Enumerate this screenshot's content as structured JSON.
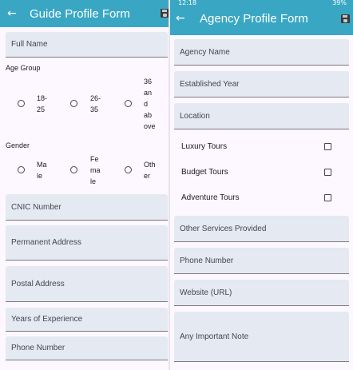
{
  "guide_form": {
    "status_time": "",
    "title": "Guide Profile Form",
    "fields": {
      "full_name": "Full Name",
      "cnic": "CNIC Number",
      "permanent_address": "Permanent Address",
      "postal_address": "Postal Address",
      "experience": "Years of Experience",
      "phone": "Phone Number"
    },
    "age_group": {
      "label": "Age Group",
      "options": [
        {
          "lines": [
            "18-",
            "25"
          ]
        },
        {
          "lines": [
            "26-",
            "35"
          ]
        },
        {
          "lines": [
            "36",
            "an",
            "d",
            "ab",
            "ove"
          ]
        }
      ]
    },
    "gender": {
      "label": "Gender",
      "options": [
        {
          "lines": [
            "Ma",
            "le"
          ]
        },
        {
          "lines": [
            "Fe",
            "ma",
            "le"
          ]
        },
        {
          "lines": [
            "Oth",
            "er"
          ]
        }
      ]
    }
  },
  "agency_form": {
    "status_time": "12:18",
    "status_right": "39%",
    "title": "Agency Profile Form",
    "fields": {
      "agency_name": "Agency Name",
      "established_year": "Established Year",
      "location": "Location",
      "other_services": "Other Services Provided",
      "phone": "Phone Number",
      "website": "Website (URL)",
      "note": "Any Important Note"
    },
    "tour_types": [
      {
        "label": "Luxury Tours",
        "checked": false
      },
      {
        "label": "Budget Tours",
        "checked": false
      },
      {
        "label": "Adventure Tours",
        "checked": false
      }
    ]
  },
  "colors": {
    "appbar": "#39a7c4",
    "field_bg": "#e4e9f2",
    "page_bg": "#fdf7ff"
  }
}
